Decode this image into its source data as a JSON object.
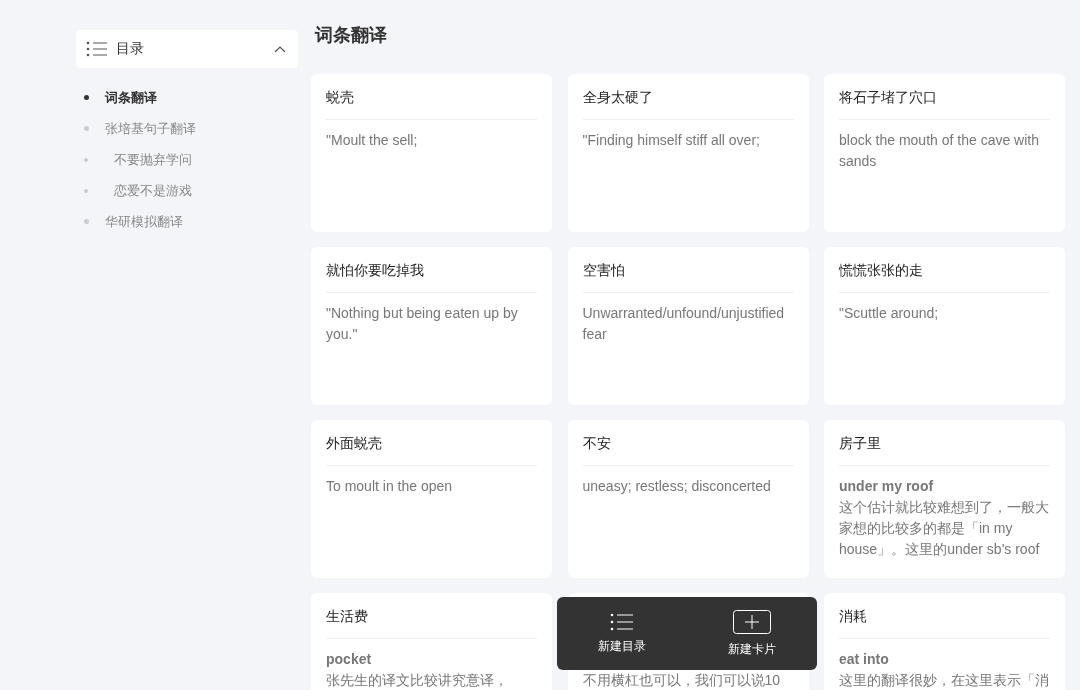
{
  "toc": {
    "title": "目录",
    "expanded": true,
    "items": [
      {
        "label": "词条翻译",
        "selected": true
      },
      {
        "label": "张培基句子翻译",
        "selected": false,
        "children": [
          {
            "label": "不要抛弃学问",
            "selected": false
          },
          {
            "label": "恋爱不是游戏",
            "selected": false
          }
        ]
      },
      {
        "label": "华研模拟翻译",
        "selected": false
      }
    ]
  },
  "page_title": "词条翻译",
  "card_rows": [
    {
      "cards": [
        {
          "title": "蜕壳",
          "text": "\"Moult the sell;"
        },
        {
          "title": "全身太硬了",
          "text": "\"Finding himself stiff all over;"
        },
        {
          "title": "将石子堵了穴口",
          "text": "block the mouth of the cave with sands"
        }
      ]
    },
    {
      "cards": [
        {
          "title": "就怕你要吃掉我",
          "text": "\"Nothing but being eaten up by you.\""
        },
        {
          "title": "空害怕",
          "text": "Unwarranted/unfound/unjustified fear"
        },
        {
          "title": "慌慌张张的走",
          "text": "\"Scuttle around;"
        }
      ]
    },
    {
      "cards": [
        {
          "title": "外面蜕壳",
          "text": "To moult in the open"
        },
        {
          "title": "不安",
          "text": "uneasy; restless; disconcerted"
        },
        {
          "title": "房子里",
          "lead": "under my roof",
          "text": "这个估计就比较难想到了，一般大家想的比较多的都是「in my house」。这里的under sb's roof"
        }
      ]
    },
    {
      "cards": [
        {
          "title": "生活费",
          "lead": "pocket",
          "text": "张先生的译文比较讲究意译，"
        },
        {
          "text": "不用横杠也可以，我们可以说10"
        },
        {
          "title": "消耗",
          "lead": "eat into",
          "text": "这里的翻译很妙，在这里表示「消"
        }
      ]
    }
  ],
  "toolbar": [
    {
      "kind": "list",
      "label": "新建目录"
    },
    {
      "kind": "add",
      "label": "新建卡片"
    }
  ]
}
